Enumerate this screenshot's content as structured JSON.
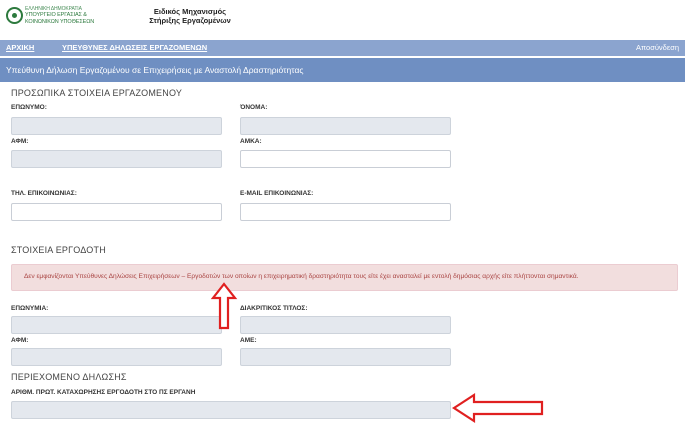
{
  "header": {
    "ministry_line1": "ΕΛΛΗΝΙΚΗ ΔΗΜΟΚΡΑΤΙΑ",
    "ministry_line2": "ΥΠΟΥΡΓΕΙΟ ΕΡΓΑΣΙΑΣ &",
    "ministry_line3": "ΚΟΙΝΩΝΙΚΩΝ ΥΠΟΘΕΣΕΩΝ",
    "app_title_line1": "Ειδικός Μηχανισμός",
    "app_title_line2": "Στήριξης Εργαζομένων"
  },
  "nav": {
    "home": "ΑΡΧΙΚΗ",
    "declarations": "ΥΠΕΥΘΥΝΕΣ ΔΗΛΩΣΕΙΣ ΕΡΓΑΖΟΜΕΝΩΝ",
    "logout": "Αποσύνδεση"
  },
  "page": {
    "title": "Υπεύθυνη Δήλωση Εργαζομένου σε Επιχειρήσεις με Αναστολή Δραστηριότητας"
  },
  "personal": {
    "heading": "ΠΡΟΣΩΠΙΚΑ ΣΤΟΙΧΕΙΑ ΕΡΓΑΖΟΜΕΝΟΥ",
    "surname_label": "ΕΠΩΝΥΜΟ:",
    "name_label": "ΌΝΟΜΑ:",
    "afm_label": "ΑΦΜ:",
    "amka_label": "ΑΜΚΑ:",
    "phone_label": "ΤΗΛ. ΕΠΙΚΟΙΝΩΝΙΑΣ:",
    "email_label": "E-MAIL ΕΠΙΚΟΙΝΩΝΙΑΣ:"
  },
  "employer": {
    "heading": "ΣΤΟΙΧΕΙΑ ΕΡΓΟΔΟΤΗ",
    "alert": "Δεν εμφανίζονται Υπεύθυνες Δηλώσεις Επιχειρήσεων – Εργοδοτών των οποίων η επιχειρηματική δραστηριότητα τους είτε έχει ανασταλεί με εντολή δημόσιας αρχής είτε πλήττονται σημαντικά.",
    "company_name_label": "ΕΠΩΝΥΜΙΑ:",
    "trade_name_label": "ΔΙΑΚΡΙΤΙΚΟΣ ΤΙΤΛΟΣ:",
    "afm_label": "ΑΦΜ:",
    "ame_label": "ΑΜΕ:"
  },
  "declaration": {
    "heading": "ΠΕΡΙΕΧΟΜΕΝΟ ΔΗΛΩΣΗΣ",
    "ergani_label": "ΑΡΙΘΜ. ΠΡΩΤ. ΚΑΤΑΧΩΡΗΣΗΣ ΕΡΓΟΔΟΤΗ ΣΤΟ ΠΣ ΕΡΓΑΝΗ"
  },
  "colors": {
    "nav": "#8ba4cf",
    "page_header": "#6f8fc2",
    "alert_bg": "#f2dede",
    "alert_text": "#a94442",
    "arrow": "#e02020"
  }
}
